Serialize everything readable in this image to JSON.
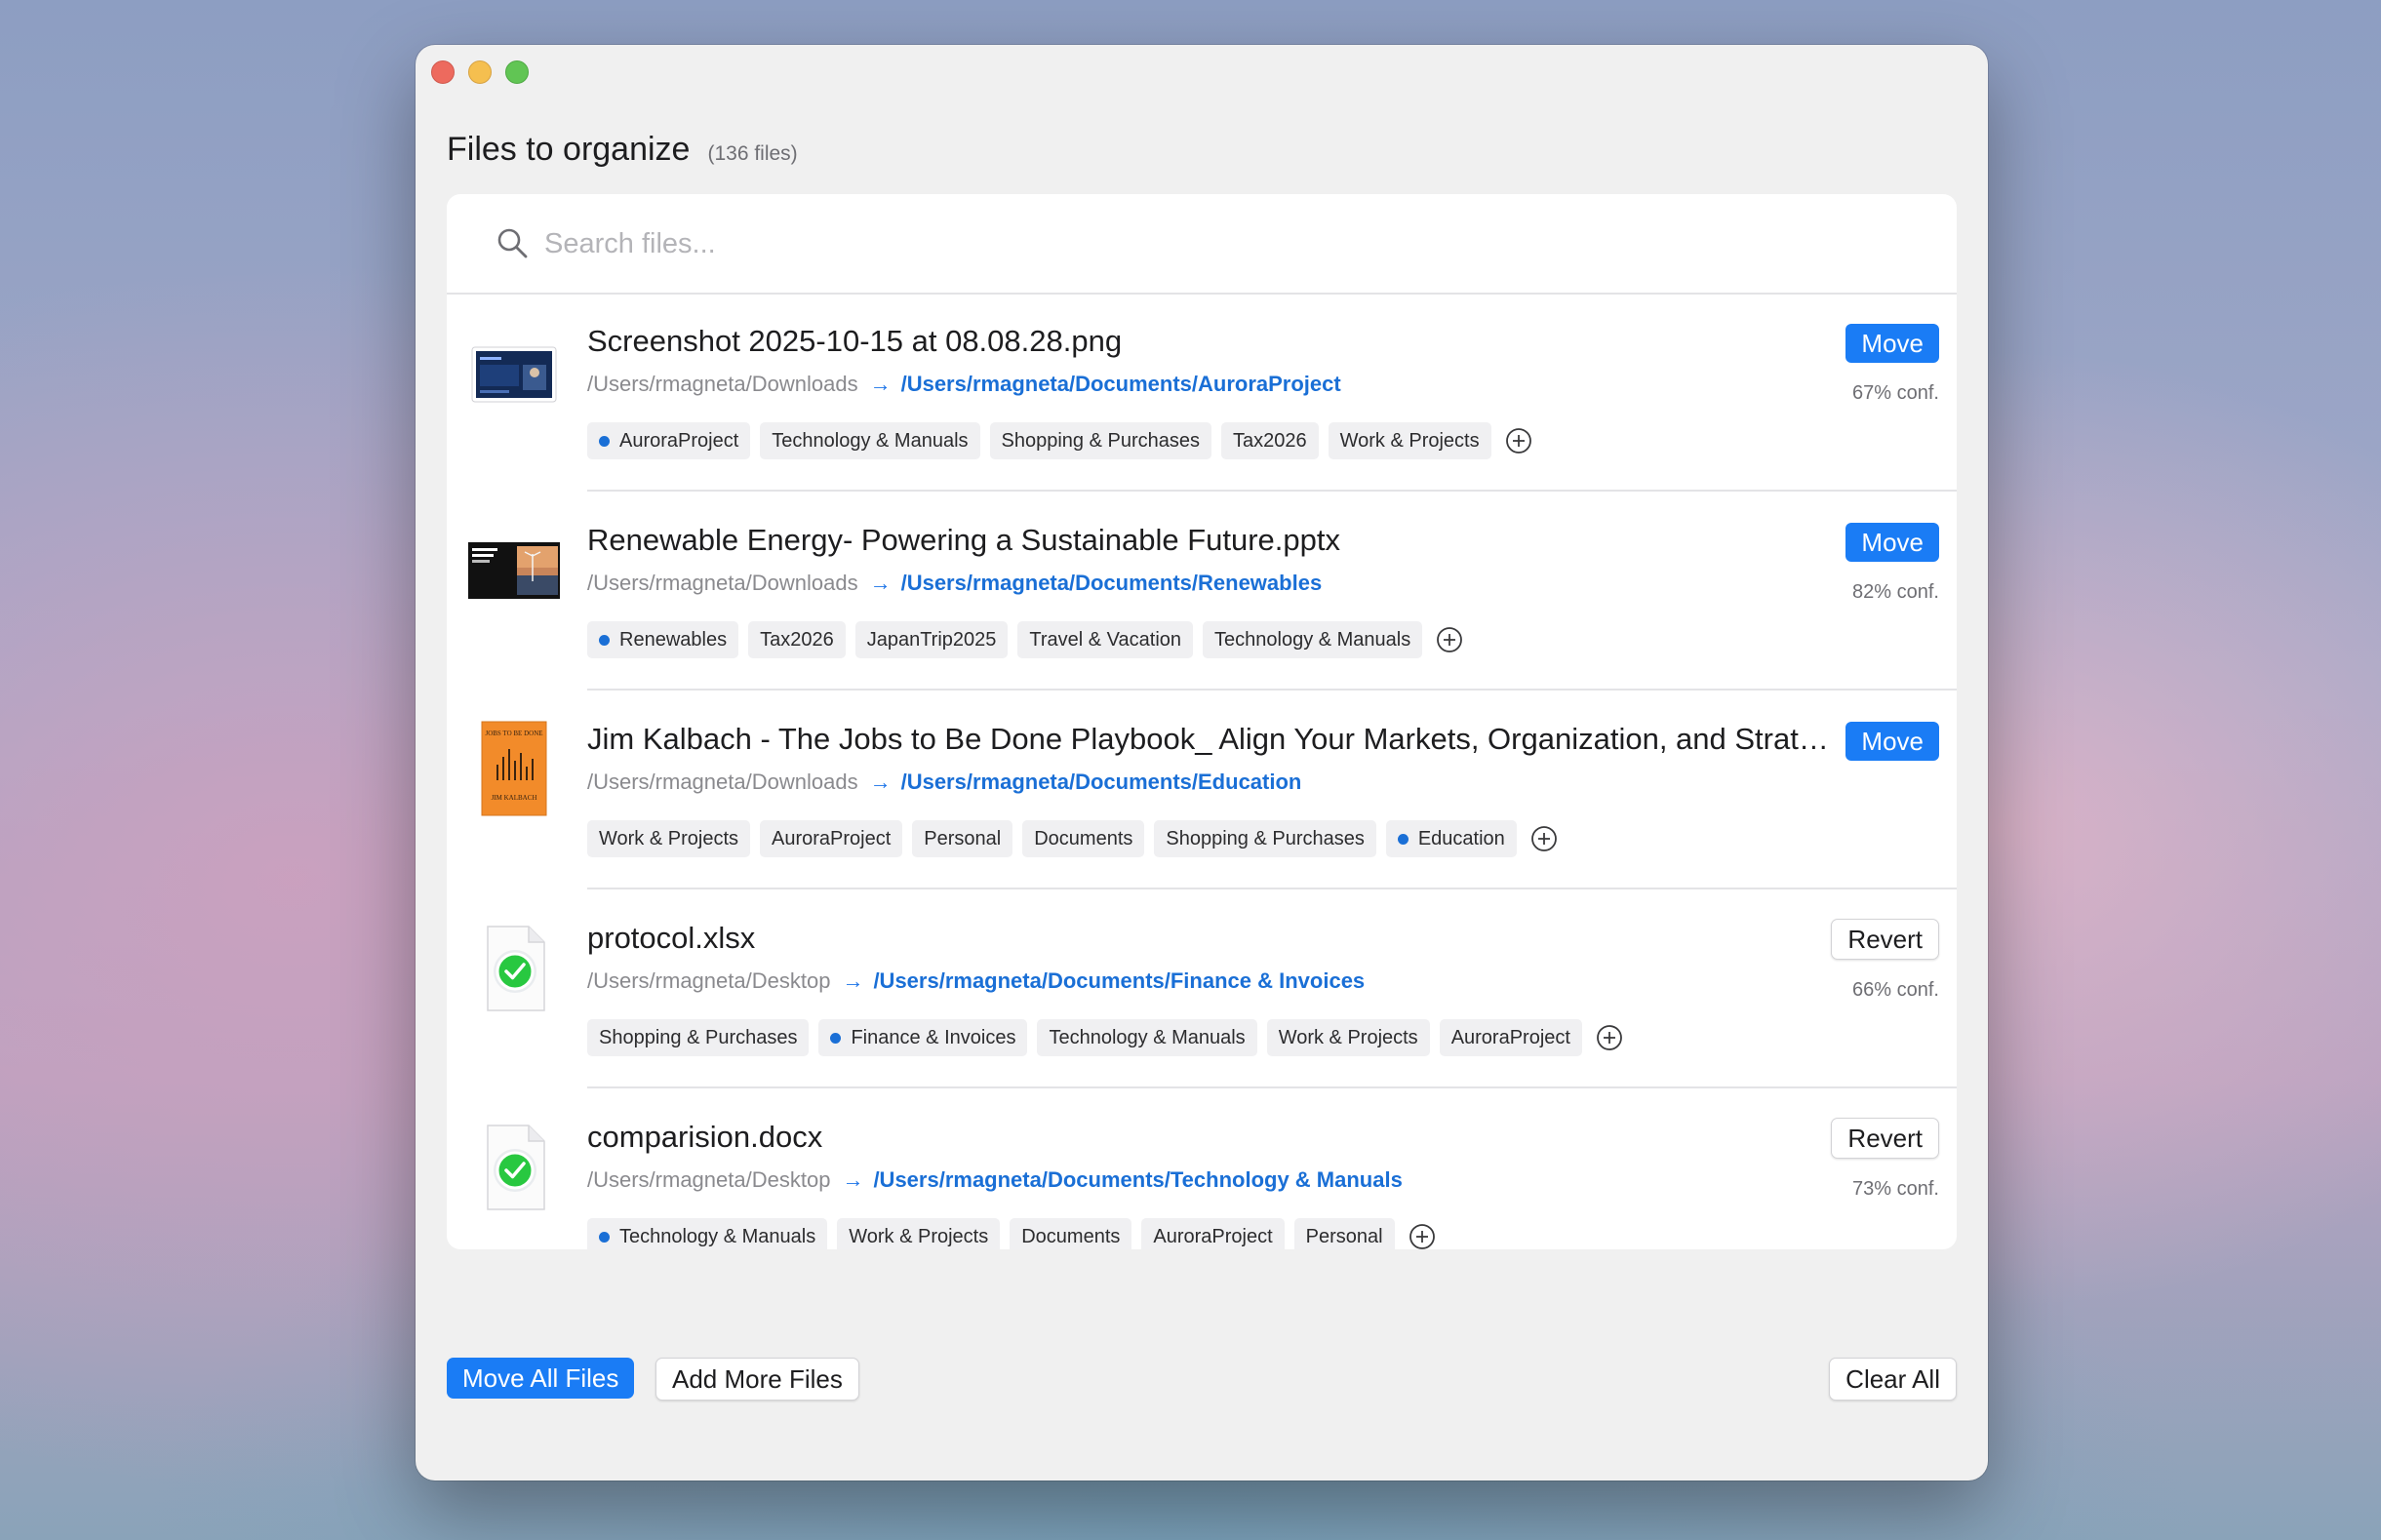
{
  "window": {
    "title": "Files to organize",
    "count": "(136 files)"
  },
  "search": {
    "placeholder": "Search files..."
  },
  "files": [
    {
      "name": "Screenshot 2025-10-15 at 08.08.28.png",
      "source": "/Users/rmagneta/Downloads",
      "destination": "/Users/rmagneta/Documents/AuroraProject",
      "action": "Move",
      "confidence": "67% conf.",
      "thumbnail": "screenshot-image",
      "tags": [
        {
          "label": "AuroraProject",
          "selected": true
        },
        {
          "label": "Technology & Manuals",
          "selected": false
        },
        {
          "label": "Shopping & Purchases",
          "selected": false
        },
        {
          "label": "Tax2026",
          "selected": false
        },
        {
          "label": "Work & Projects",
          "selected": false
        }
      ]
    },
    {
      "name": "Renewable Energy- Powering a Sustainable Future.pptx",
      "source": "/Users/rmagneta/Downloads",
      "destination": "/Users/rmagneta/Documents/Renewables",
      "action": "Move",
      "confidence": "82% conf.",
      "thumbnail": "presentation-slide",
      "tags": [
        {
          "label": "Renewables",
          "selected": true
        },
        {
          "label": "Tax2026",
          "selected": false
        },
        {
          "label": "JapanTrip2025",
          "selected": false
        },
        {
          "label": "Travel & Vacation",
          "selected": false
        },
        {
          "label": "Technology & Manuals",
          "selected": false
        }
      ]
    },
    {
      "name": "Jim Kalbach - The Jobs to Be Done Playbook_ Align Your Markets, Organization, and Strate...",
      "source": "/Users/rmagneta/Downloads",
      "destination": "/Users/rmagneta/Documents/Education",
      "action": "Move",
      "confidence": "",
      "thumbnail": "book-cover",
      "tags": [
        {
          "label": "Work & Projects",
          "selected": false
        },
        {
          "label": "AuroraProject",
          "selected": false
        },
        {
          "label": "Personal",
          "selected": false
        },
        {
          "label": "Documents",
          "selected": false
        },
        {
          "label": "Shopping & Purchases",
          "selected": false
        },
        {
          "label": "Education",
          "selected": true
        }
      ]
    },
    {
      "name": "protocol.xlsx",
      "source": "/Users/rmagneta/Desktop",
      "destination": "/Users/rmagneta/Documents/Finance & Invoices",
      "action": "Revert",
      "confidence": "66% conf.",
      "thumbnail": "moved-checkmark",
      "tags": [
        {
          "label": "Shopping & Purchases",
          "selected": false
        },
        {
          "label": "Finance & Invoices",
          "selected": true
        },
        {
          "label": "Technology & Manuals",
          "selected": false
        },
        {
          "label": "Work & Projects",
          "selected": false
        },
        {
          "label": "AuroraProject",
          "selected": false
        }
      ]
    },
    {
      "name": "comparision.docx",
      "source": "/Users/rmagneta/Desktop",
      "destination": "/Users/rmagneta/Documents/Technology & Manuals",
      "action": "Revert",
      "confidence": "73% conf.",
      "thumbnail": "moved-checkmark",
      "tags": [
        {
          "label": "Technology & Manuals",
          "selected": true
        },
        {
          "label": "Work & Projects",
          "selected": false
        },
        {
          "label": "Documents",
          "selected": false
        },
        {
          "label": "AuroraProject",
          "selected": false
        },
        {
          "label": "Personal",
          "selected": false
        }
      ]
    }
  ],
  "footer": {
    "move_all": "Move All Files",
    "add_more": "Add More Files",
    "clear_all": "Clear All"
  },
  "colors": {
    "accent": "#1a7cf5",
    "link": "#1a6fd6",
    "success": "#28c840"
  },
  "book_cover_text": {
    "top": "JOBS TO BE DONE",
    "author": "JIM KALBACH"
  }
}
